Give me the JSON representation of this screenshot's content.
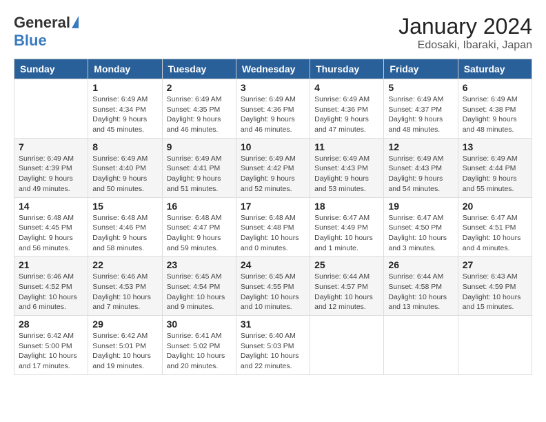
{
  "header": {
    "logo_general": "General",
    "logo_blue": "Blue",
    "title": "January 2024",
    "subtitle": "Edosaki, Ibaraki, Japan"
  },
  "calendar": {
    "days_of_week": [
      "Sunday",
      "Monday",
      "Tuesday",
      "Wednesday",
      "Thursday",
      "Friday",
      "Saturday"
    ],
    "weeks": [
      [
        {
          "day": "",
          "info": ""
        },
        {
          "day": "1",
          "info": "Sunrise: 6:49 AM\nSunset: 4:34 PM\nDaylight: 9 hours\nand 45 minutes."
        },
        {
          "day": "2",
          "info": "Sunrise: 6:49 AM\nSunset: 4:35 PM\nDaylight: 9 hours\nand 46 minutes."
        },
        {
          "day": "3",
          "info": "Sunrise: 6:49 AM\nSunset: 4:36 PM\nDaylight: 9 hours\nand 46 minutes."
        },
        {
          "day": "4",
          "info": "Sunrise: 6:49 AM\nSunset: 4:36 PM\nDaylight: 9 hours\nand 47 minutes."
        },
        {
          "day": "5",
          "info": "Sunrise: 6:49 AM\nSunset: 4:37 PM\nDaylight: 9 hours\nand 48 minutes."
        },
        {
          "day": "6",
          "info": "Sunrise: 6:49 AM\nSunset: 4:38 PM\nDaylight: 9 hours\nand 48 minutes."
        }
      ],
      [
        {
          "day": "7",
          "info": "Sunrise: 6:49 AM\nSunset: 4:39 PM\nDaylight: 9 hours\nand 49 minutes."
        },
        {
          "day": "8",
          "info": "Sunrise: 6:49 AM\nSunset: 4:40 PM\nDaylight: 9 hours\nand 50 minutes."
        },
        {
          "day": "9",
          "info": "Sunrise: 6:49 AM\nSunset: 4:41 PM\nDaylight: 9 hours\nand 51 minutes."
        },
        {
          "day": "10",
          "info": "Sunrise: 6:49 AM\nSunset: 4:42 PM\nDaylight: 9 hours\nand 52 minutes."
        },
        {
          "day": "11",
          "info": "Sunrise: 6:49 AM\nSunset: 4:43 PM\nDaylight: 9 hours\nand 53 minutes."
        },
        {
          "day": "12",
          "info": "Sunrise: 6:49 AM\nSunset: 4:43 PM\nDaylight: 9 hours\nand 54 minutes."
        },
        {
          "day": "13",
          "info": "Sunrise: 6:49 AM\nSunset: 4:44 PM\nDaylight: 9 hours\nand 55 minutes."
        }
      ],
      [
        {
          "day": "14",
          "info": "Sunrise: 6:48 AM\nSunset: 4:45 PM\nDaylight: 9 hours\nand 56 minutes."
        },
        {
          "day": "15",
          "info": "Sunrise: 6:48 AM\nSunset: 4:46 PM\nDaylight: 9 hours\nand 58 minutes."
        },
        {
          "day": "16",
          "info": "Sunrise: 6:48 AM\nSunset: 4:47 PM\nDaylight: 9 hours\nand 59 minutes."
        },
        {
          "day": "17",
          "info": "Sunrise: 6:48 AM\nSunset: 4:48 PM\nDaylight: 10 hours\nand 0 minutes."
        },
        {
          "day": "18",
          "info": "Sunrise: 6:47 AM\nSunset: 4:49 PM\nDaylight: 10 hours\nand 1 minute."
        },
        {
          "day": "19",
          "info": "Sunrise: 6:47 AM\nSunset: 4:50 PM\nDaylight: 10 hours\nand 3 minutes."
        },
        {
          "day": "20",
          "info": "Sunrise: 6:47 AM\nSunset: 4:51 PM\nDaylight: 10 hours\nand 4 minutes."
        }
      ],
      [
        {
          "day": "21",
          "info": "Sunrise: 6:46 AM\nSunset: 4:52 PM\nDaylight: 10 hours\nand 6 minutes."
        },
        {
          "day": "22",
          "info": "Sunrise: 6:46 AM\nSunset: 4:53 PM\nDaylight: 10 hours\nand 7 minutes."
        },
        {
          "day": "23",
          "info": "Sunrise: 6:45 AM\nSunset: 4:54 PM\nDaylight: 10 hours\nand 9 minutes."
        },
        {
          "day": "24",
          "info": "Sunrise: 6:45 AM\nSunset: 4:55 PM\nDaylight: 10 hours\nand 10 minutes."
        },
        {
          "day": "25",
          "info": "Sunrise: 6:44 AM\nSunset: 4:57 PM\nDaylight: 10 hours\nand 12 minutes."
        },
        {
          "day": "26",
          "info": "Sunrise: 6:44 AM\nSunset: 4:58 PM\nDaylight: 10 hours\nand 13 minutes."
        },
        {
          "day": "27",
          "info": "Sunrise: 6:43 AM\nSunset: 4:59 PM\nDaylight: 10 hours\nand 15 minutes."
        }
      ],
      [
        {
          "day": "28",
          "info": "Sunrise: 6:42 AM\nSunset: 5:00 PM\nDaylight: 10 hours\nand 17 minutes."
        },
        {
          "day": "29",
          "info": "Sunrise: 6:42 AM\nSunset: 5:01 PM\nDaylight: 10 hours\nand 19 minutes."
        },
        {
          "day": "30",
          "info": "Sunrise: 6:41 AM\nSunset: 5:02 PM\nDaylight: 10 hours\nand 20 minutes."
        },
        {
          "day": "31",
          "info": "Sunrise: 6:40 AM\nSunset: 5:03 PM\nDaylight: 10 hours\nand 22 minutes."
        },
        {
          "day": "",
          "info": ""
        },
        {
          "day": "",
          "info": ""
        },
        {
          "day": "",
          "info": ""
        }
      ]
    ]
  }
}
